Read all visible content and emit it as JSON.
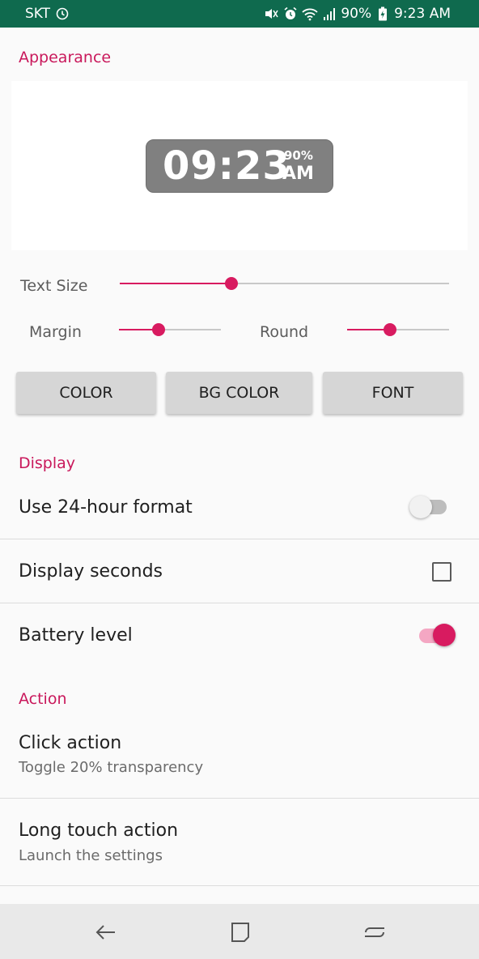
{
  "status_bar": {
    "carrier": "SKT",
    "battery": "90%",
    "time": "9:23 AM"
  },
  "appearance": {
    "section_title": "Appearance",
    "preview": {
      "time": "09:23",
      "battery": "90%",
      "ampm": "AM"
    },
    "text_size": {
      "label": "Text Size",
      "value": 0.34
    },
    "margin": {
      "label": "Margin",
      "value": 0.39
    },
    "round": {
      "label": "Round",
      "value": 0.42
    },
    "buttons": {
      "color": "COLOR",
      "bg_color": "BG COLOR",
      "font": "FONT"
    }
  },
  "display": {
    "section_title": "Display",
    "use_24_hour": {
      "label": "Use 24-hour format",
      "enabled": false
    },
    "display_seconds": {
      "label": "Display seconds",
      "checked": false
    },
    "battery_level": {
      "label": "Battery level",
      "enabled": true
    }
  },
  "action": {
    "section_title": "Action",
    "click_action": {
      "title": "Click action",
      "summary": "Toggle 20% transparency"
    },
    "long_touch_action": {
      "title": "Long touch action",
      "summary": "Launch the settings"
    }
  },
  "colors": {
    "accent": "#d81b60",
    "status_bar": "#0f6a4e"
  },
  "nav_icons": [
    "back-icon",
    "recents-icon",
    "home-icon"
  ]
}
